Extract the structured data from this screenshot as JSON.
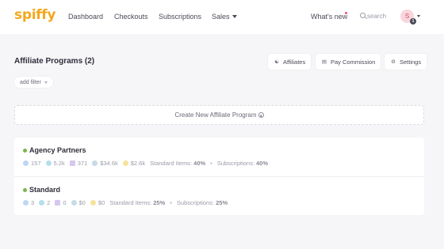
{
  "app": {
    "logo": "spiffy"
  },
  "nav": {
    "links": [
      "Dashboard",
      "Checkouts",
      "Subscriptions",
      "Sales"
    ],
    "whats_new": "What's new",
    "search_placeholder": "search",
    "avatar_initial": "S",
    "avatar_badge": "1"
  },
  "header": {
    "title": "Affiliate Programs (2)",
    "buttons": [
      "Affiliates",
      "Pay Commission",
      "Settings"
    ],
    "filter_label": "add filter"
  },
  "create_label": "Create New Affiliate Program",
  "programs": [
    {
      "name": "Agency Partners",
      "status_color": "#7ab648",
      "stats": [
        "157",
        "5.2k",
        "371",
        "$34.6k",
        "$2.6k"
      ],
      "standard_items_label": "Standard Items:",
      "standard_items_value": "40%",
      "subscriptions_label": "Subscriptions:",
      "subscriptions_value": "40%"
    },
    {
      "name": "Standard",
      "status_color": "#7ab648",
      "stats": [
        "3",
        "2",
        "0",
        "$0",
        "$0"
      ],
      "standard_items_label": "Standard Items:",
      "standard_items_value": "25%",
      "subscriptions_label": "Subscriptions:",
      "subscriptions_value": "25%"
    }
  ],
  "colors": {
    "brand": "#f2a81d",
    "active": "#7ab648",
    "notify": "#ef4b6a"
  }
}
